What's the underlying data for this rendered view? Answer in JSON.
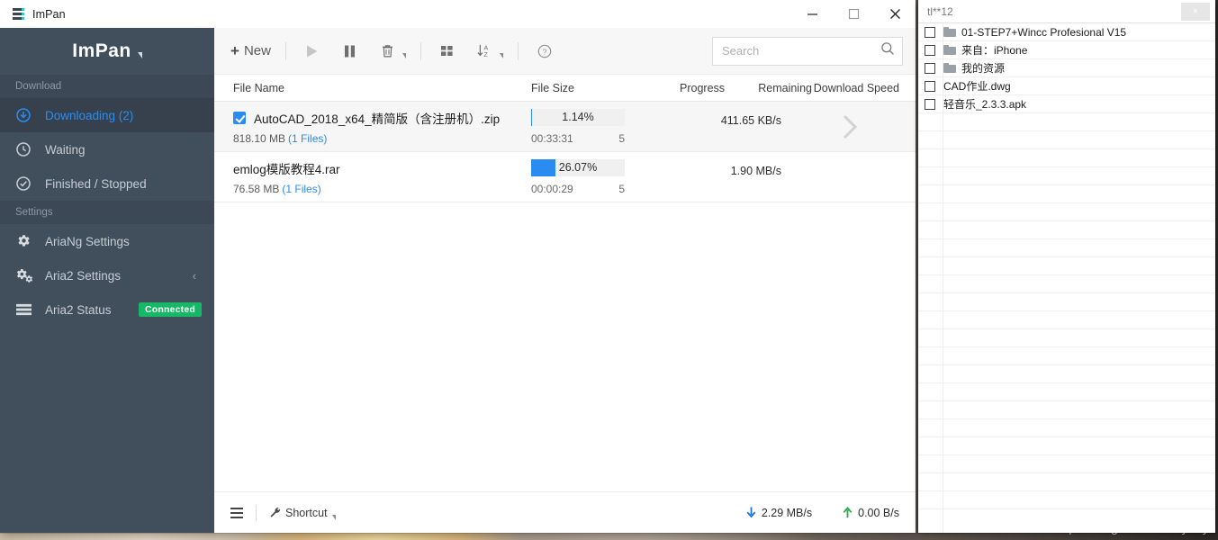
{
  "window": {
    "title": "ImPan",
    "icon": "app-stack-icon",
    "controls": {
      "minimize": "–",
      "maximize": "□",
      "close": "✕"
    }
  },
  "sidebar": {
    "brand": "ImPan",
    "groups": [
      {
        "label": "Download",
        "items": [
          {
            "label": "Downloading (2)",
            "icon": "download-circle-icon",
            "active": true
          },
          {
            "label": "Waiting",
            "icon": "clock-icon",
            "active": false
          },
          {
            "label": "Finished / Stopped",
            "icon": "check-circle-icon",
            "active": false
          }
        ]
      },
      {
        "label": "Settings",
        "items": [
          {
            "label": "AriaNg Settings",
            "icon": "gear-icon",
            "active": false
          },
          {
            "label": "Aria2 Settings",
            "icon": "gears-icon",
            "active": false,
            "chevron": "‹"
          },
          {
            "label": "Aria2 Status",
            "icon": "server-icon",
            "active": false,
            "badge": "Connected"
          }
        ]
      }
    ],
    "badge_color": "#17b865",
    "accent_color": "#2a8cf0"
  },
  "toolbar": {
    "new_label": "New",
    "new_plus": "+",
    "icons": [
      {
        "name": "play-icon",
        "label": "Start"
      },
      {
        "name": "pause-icon",
        "label": "Pause"
      },
      {
        "name": "trash-icon",
        "label": "Delete"
      },
      {
        "name": "grid-view-icon",
        "label": "View"
      },
      {
        "name": "sort-az-icon",
        "label": "Sort"
      },
      {
        "name": "help-icon",
        "label": "Help"
      }
    ],
    "search": {
      "placeholder": "Search",
      "value": "",
      "icon": "search-icon"
    }
  },
  "list": {
    "columns": [
      "File Name",
      "File Size",
      "Progress",
      "Remaining",
      "Download Speed"
    ],
    "rows": [
      {
        "checked": true,
        "name": "AutoCAD_2018_x64_精简版（含注册机）.zip",
        "size": "818.10 MB",
        "files": "(1 Files)",
        "percent": "1.14%",
        "percent_value": 1.14,
        "remaining": "00:33:31",
        "connections": "5",
        "speed": "411.65 KB/s",
        "selected": true,
        "has_arrow": true
      },
      {
        "checked": false,
        "name": "emlog模版教程4.rar",
        "size": "76.58 MB",
        "files": "(1 Files)",
        "percent": "26.07%",
        "percent_value": 26.07,
        "remaining": "00:00:29",
        "connections": "5",
        "speed": "1.90 MB/s",
        "selected": false,
        "has_arrow": false
      }
    ]
  },
  "statusbar": {
    "menu_icon": "hamburger-icon",
    "shortcut_label": "Shortcut",
    "shortcut_icon": "wrench-icon",
    "download_speed": "2.29 MB/s",
    "upload_speed": "0.00 B/s",
    "download_icon": "arrow-down-icon",
    "upload_icon": "arrow-up-icon",
    "download_color": "#1a73e8",
    "upload_color": "#2aa84a"
  },
  "right_panel": {
    "title": "tl**12",
    "close_label": "×",
    "items": [
      {
        "name": "01-STEP7+Wincc Profesional V15",
        "is_folder": true,
        "checked": false
      },
      {
        "name": "来自：iPhone",
        "is_folder": true,
        "checked": false
      },
      {
        "name": "我的资源",
        "is_folder": true,
        "checked": false
      },
      {
        "name": "CAD作业.dwg",
        "is_folder": false,
        "checked": false
      },
      {
        "name": "轻音乐_2.3.3.apk",
        "is_folder": false,
        "checked": false
      }
    ],
    "empty_rows": 22
  },
  "watermark": "https://blog.csdn.net/eyunyu"
}
